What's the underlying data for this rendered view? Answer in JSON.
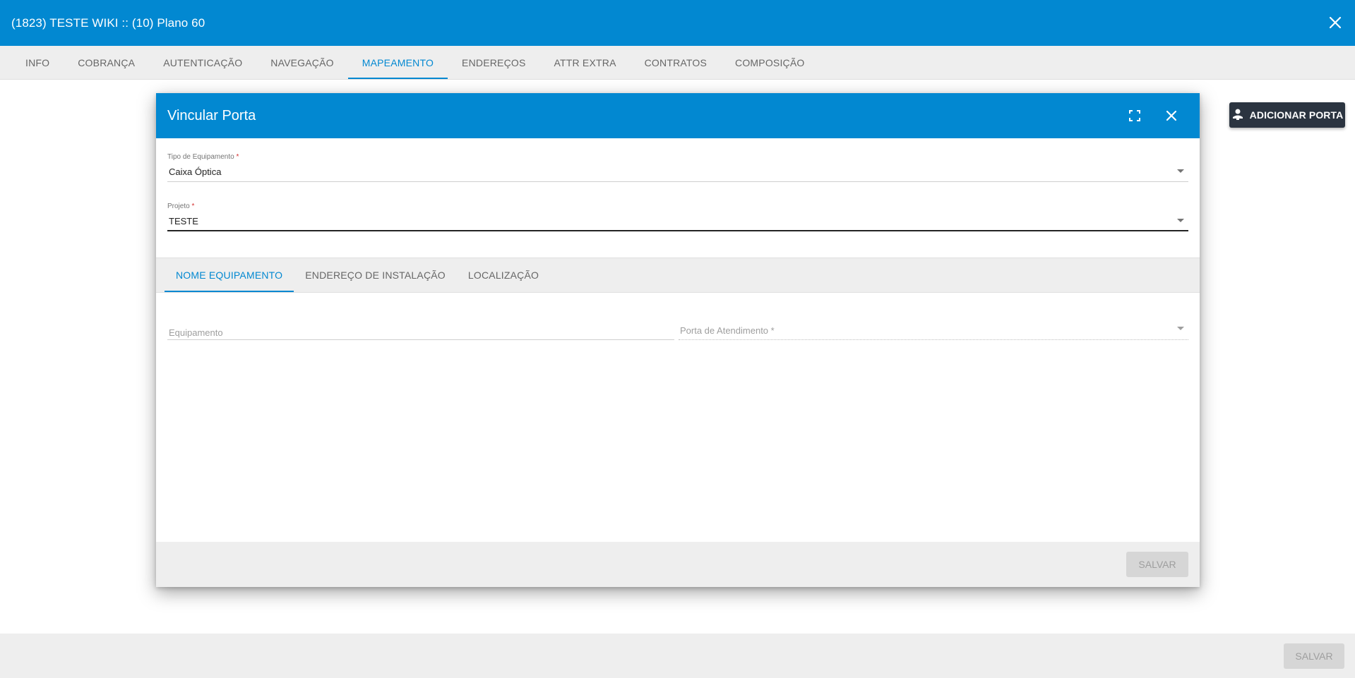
{
  "header": {
    "title": "(1823) TESTE WIKI :: (10) Plano 60",
    "close_icon": "close-icon"
  },
  "main_tabs": [
    {
      "label": "INFO"
    },
    {
      "label": "COBRANÇA"
    },
    {
      "label": "AUTENTICAÇÃO"
    },
    {
      "label": "NAVEGAÇÃO"
    },
    {
      "label": "MAPEAMENTO",
      "active": true
    },
    {
      "label": "ENDEREÇOS"
    },
    {
      "label": "ATTR EXTRA"
    },
    {
      "label": "CONTRATOS"
    },
    {
      "label": "COMPOSIÇÃO"
    }
  ],
  "toolbar": {
    "add_port_label": "ADICIONAR PORTA",
    "add_port_icon": "person-add-icon"
  },
  "footer": {
    "save_label": "SALVAR"
  },
  "dialog": {
    "title": "Vincular Porta",
    "maximize_icon": "fullscreen-icon",
    "close_icon": "close-icon",
    "tipo_equipamento": {
      "label": "Tipo de Equipamento",
      "required_mark": "*",
      "value": "Caixa Óptica"
    },
    "projeto": {
      "label": "Projeto",
      "required_mark": "*",
      "value": "TESTE"
    },
    "tabs": [
      {
        "label": "NOME EQUIPAMENTO",
        "active": true
      },
      {
        "label": "ENDEREÇO DE INSTALAÇÃO"
      },
      {
        "label": "LOCALIZAÇÃO"
      }
    ],
    "equipamento": {
      "placeholder": "Equipamento"
    },
    "porta_atendimento": {
      "placeholder": "Porta de Atendimento *"
    },
    "save_label": "SALVAR"
  },
  "colors": {
    "primary": "#0288d1",
    "dark_button": "#2b3440",
    "required": "#d32f2f",
    "disabled_button": "#d6d6d6"
  }
}
